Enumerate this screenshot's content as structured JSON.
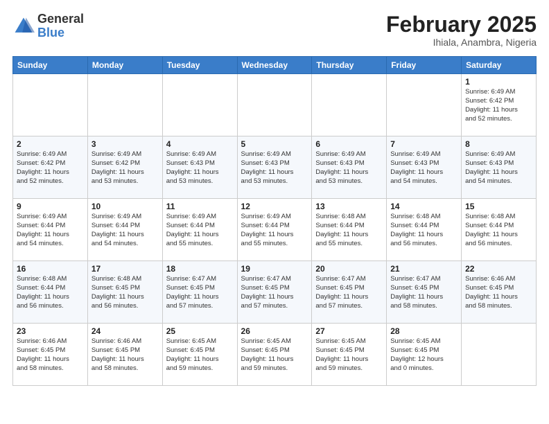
{
  "header": {
    "logo_general": "General",
    "logo_blue": "Blue",
    "month_title": "February 2025",
    "location": "Ihiala, Anambra, Nigeria"
  },
  "weekdays": [
    "Sunday",
    "Monday",
    "Tuesday",
    "Wednesday",
    "Thursday",
    "Friday",
    "Saturday"
  ],
  "weeks": [
    [
      {
        "day": "",
        "info": ""
      },
      {
        "day": "",
        "info": ""
      },
      {
        "day": "",
        "info": ""
      },
      {
        "day": "",
        "info": ""
      },
      {
        "day": "",
        "info": ""
      },
      {
        "day": "",
        "info": ""
      },
      {
        "day": "1",
        "info": "Sunrise: 6:49 AM\nSunset: 6:42 PM\nDaylight: 11 hours\nand 52 minutes."
      }
    ],
    [
      {
        "day": "2",
        "info": "Sunrise: 6:49 AM\nSunset: 6:42 PM\nDaylight: 11 hours\nand 52 minutes."
      },
      {
        "day": "3",
        "info": "Sunrise: 6:49 AM\nSunset: 6:42 PM\nDaylight: 11 hours\nand 53 minutes."
      },
      {
        "day": "4",
        "info": "Sunrise: 6:49 AM\nSunset: 6:43 PM\nDaylight: 11 hours\nand 53 minutes."
      },
      {
        "day": "5",
        "info": "Sunrise: 6:49 AM\nSunset: 6:43 PM\nDaylight: 11 hours\nand 53 minutes."
      },
      {
        "day": "6",
        "info": "Sunrise: 6:49 AM\nSunset: 6:43 PM\nDaylight: 11 hours\nand 53 minutes."
      },
      {
        "day": "7",
        "info": "Sunrise: 6:49 AM\nSunset: 6:43 PM\nDaylight: 11 hours\nand 54 minutes."
      },
      {
        "day": "8",
        "info": "Sunrise: 6:49 AM\nSunset: 6:43 PM\nDaylight: 11 hours\nand 54 minutes."
      }
    ],
    [
      {
        "day": "9",
        "info": "Sunrise: 6:49 AM\nSunset: 6:44 PM\nDaylight: 11 hours\nand 54 minutes."
      },
      {
        "day": "10",
        "info": "Sunrise: 6:49 AM\nSunset: 6:44 PM\nDaylight: 11 hours\nand 54 minutes."
      },
      {
        "day": "11",
        "info": "Sunrise: 6:49 AM\nSunset: 6:44 PM\nDaylight: 11 hours\nand 55 minutes."
      },
      {
        "day": "12",
        "info": "Sunrise: 6:49 AM\nSunset: 6:44 PM\nDaylight: 11 hours\nand 55 minutes."
      },
      {
        "day": "13",
        "info": "Sunrise: 6:48 AM\nSunset: 6:44 PM\nDaylight: 11 hours\nand 55 minutes."
      },
      {
        "day": "14",
        "info": "Sunrise: 6:48 AM\nSunset: 6:44 PM\nDaylight: 11 hours\nand 56 minutes."
      },
      {
        "day": "15",
        "info": "Sunrise: 6:48 AM\nSunset: 6:44 PM\nDaylight: 11 hours\nand 56 minutes."
      }
    ],
    [
      {
        "day": "16",
        "info": "Sunrise: 6:48 AM\nSunset: 6:44 PM\nDaylight: 11 hours\nand 56 minutes."
      },
      {
        "day": "17",
        "info": "Sunrise: 6:48 AM\nSunset: 6:45 PM\nDaylight: 11 hours\nand 56 minutes."
      },
      {
        "day": "18",
        "info": "Sunrise: 6:47 AM\nSunset: 6:45 PM\nDaylight: 11 hours\nand 57 minutes."
      },
      {
        "day": "19",
        "info": "Sunrise: 6:47 AM\nSunset: 6:45 PM\nDaylight: 11 hours\nand 57 minutes."
      },
      {
        "day": "20",
        "info": "Sunrise: 6:47 AM\nSunset: 6:45 PM\nDaylight: 11 hours\nand 57 minutes."
      },
      {
        "day": "21",
        "info": "Sunrise: 6:47 AM\nSunset: 6:45 PM\nDaylight: 11 hours\nand 58 minutes."
      },
      {
        "day": "22",
        "info": "Sunrise: 6:46 AM\nSunset: 6:45 PM\nDaylight: 11 hours\nand 58 minutes."
      }
    ],
    [
      {
        "day": "23",
        "info": "Sunrise: 6:46 AM\nSunset: 6:45 PM\nDaylight: 11 hours\nand 58 minutes."
      },
      {
        "day": "24",
        "info": "Sunrise: 6:46 AM\nSunset: 6:45 PM\nDaylight: 11 hours\nand 58 minutes."
      },
      {
        "day": "25",
        "info": "Sunrise: 6:45 AM\nSunset: 6:45 PM\nDaylight: 11 hours\nand 59 minutes."
      },
      {
        "day": "26",
        "info": "Sunrise: 6:45 AM\nSunset: 6:45 PM\nDaylight: 11 hours\nand 59 minutes."
      },
      {
        "day": "27",
        "info": "Sunrise: 6:45 AM\nSunset: 6:45 PM\nDaylight: 11 hours\nand 59 minutes."
      },
      {
        "day": "28",
        "info": "Sunrise: 6:45 AM\nSunset: 6:45 PM\nDaylight: 12 hours\nand 0 minutes."
      },
      {
        "day": "",
        "info": ""
      }
    ]
  ]
}
